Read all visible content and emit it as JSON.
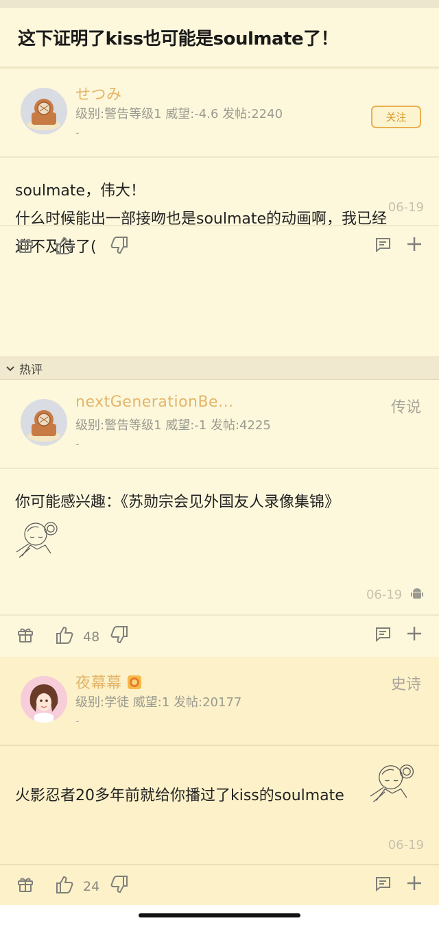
{
  "thread": {
    "title": "这下证明了kiss也可能是soulmate了！"
  },
  "posts": [
    {
      "username": "せつみ",
      "meta": "级别:警告等级1 威望:-4.6 发帖:2240",
      "dash": "-",
      "follow_label": "关注",
      "content_lines": [
        "soulmate，伟大！",
        "什么时候能出一部接吻也是soulmate的动画啊，我已经",
        "迫不及待了("
      ],
      "date": "06-19"
    },
    {
      "username": "nextGenerationBe...",
      "meta": "级别:警告等级1 威望:-1 发帖:4225",
      "dash": "-",
      "rank": "传说",
      "content": "你可能感兴趣：《苏勋宗会见外国友人录像集锦》",
      "date": "06-19",
      "likes": "48"
    },
    {
      "username": "夜幕幕",
      "meta": "级别:学徒 威望:1 发帖:20177",
      "dash": "-",
      "rank": "史诗",
      "content": "火影忍者20多年前就给你播过了kiss的soulmate",
      "date": "06-19",
      "likes": "24"
    }
  ],
  "hot_section_label": "热评",
  "icons": [
    "gift-icon",
    "thumbs-up-icon",
    "thumbs-down-icon",
    "comment-icon",
    "plus-icon",
    "android-icon",
    "chevron-down-icon"
  ],
  "colors": {
    "background": "#fdf8dc",
    "username": "#e3b56a",
    "follow_border": "#e9b052"
  }
}
